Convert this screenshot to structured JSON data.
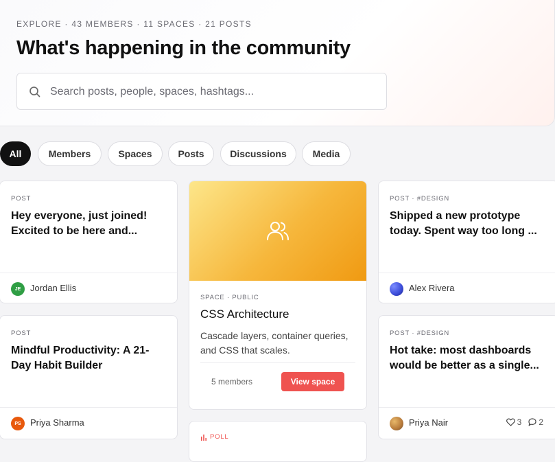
{
  "header": {
    "kicker": "EXPLORE · 43 MEMBERS · 11 SPACES · 21 POSTS",
    "title": "What's happening in the community"
  },
  "search": {
    "placeholder": "Search posts, people, spaces, hashtags...",
    "value": "",
    "icon": "search-icon"
  },
  "filters": [
    {
      "label": "All",
      "active": true
    },
    {
      "label": "Members",
      "active": false
    },
    {
      "label": "Spaces",
      "active": false
    },
    {
      "label": "Posts",
      "active": false
    },
    {
      "label": "Discussions",
      "active": false
    },
    {
      "label": "Media",
      "active": false
    }
  ],
  "cards": {
    "post1": {
      "tag": "POST",
      "title": "Hey everyone, just joined! Excited to be here and...",
      "author": "Jordan Ellis",
      "initials": "JE",
      "avatar_color": "#2f9e44"
    },
    "post2": {
      "tag": "POST",
      "title": "Mindful Productivity: A 21-Day Habit Builder",
      "author": "Priya Sharma",
      "initials": "PS",
      "avatar_color": "#e8590c"
    },
    "space": {
      "tag": "SPACE · PUBLIC",
      "title": "CSS Architecture",
      "description": "Cascade layers, container queries, and CSS that scales.",
      "members": "5 members",
      "button": "View space",
      "icon": "users-icon"
    },
    "poll": {
      "tag": "POLL"
    },
    "post3": {
      "tag": "POST · #DESIGN",
      "title": "Shipped a new prototype today. Spent way too long ...",
      "author": "Alex Rivera"
    },
    "post4": {
      "tag": "POST · #DESIGN",
      "title": "Hot take: most dashboards would be better as a single...",
      "author": "Priya Nair",
      "likes": "3",
      "comments": "2"
    }
  },
  "colors": {
    "accent": "#ef5350",
    "chip_active": "#111111",
    "space_banner": "#f6b73c"
  }
}
